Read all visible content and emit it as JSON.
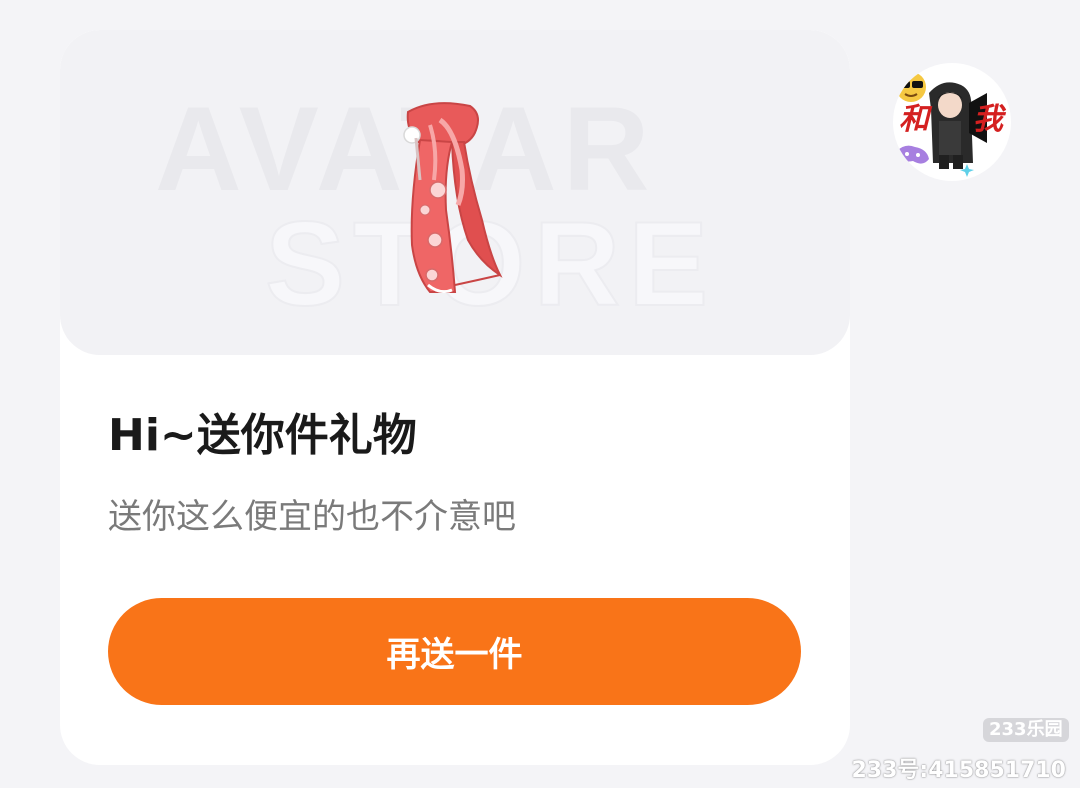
{
  "banner": {
    "watermark_line1": "AVATAR",
    "watermark_line2": "STORE"
  },
  "gift": {
    "image_icon": "red-qipao-skirt-icon"
  },
  "card": {
    "title": "Hi~送你件礼物",
    "subtitle": "送你这么便宜的也不介意吧",
    "button_label": "再送一件"
  },
  "avatar": {
    "icon": "user-avatar",
    "caption_left": "和",
    "caption_right": "我"
  },
  "watermark": {
    "logo": "233乐园",
    "user_id": "233号:415851710"
  },
  "colors": {
    "accent": "#f97418",
    "card_bg": "#ffffff",
    "page_bg": "#f4f4f7",
    "gift_red": "#ec5b5b"
  }
}
